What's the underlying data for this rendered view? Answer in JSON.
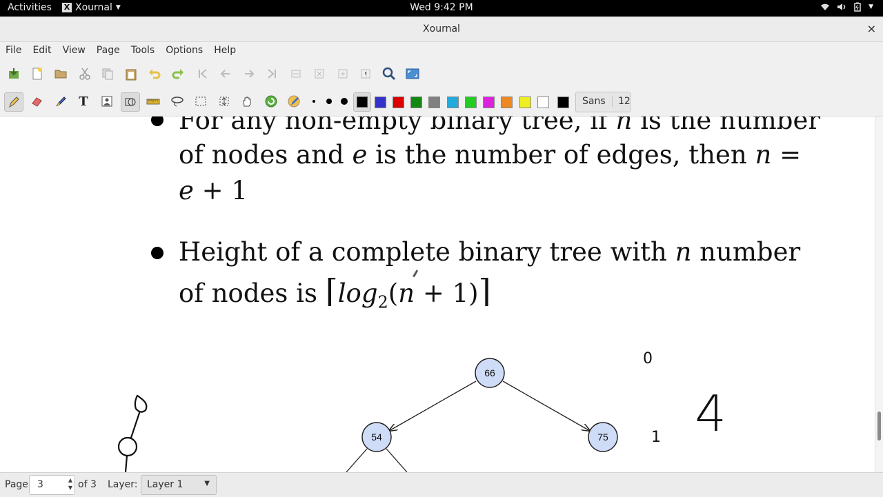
{
  "topbar": {
    "activities": "Activities",
    "app_name": "Xournal",
    "app_icon": "X",
    "clock": "Wed  9:42 PM"
  },
  "window": {
    "title": "Xournal",
    "close": "×"
  },
  "menu": {
    "items": [
      "File",
      "Edit",
      "View",
      "Page",
      "Tools",
      "Options",
      "Help"
    ]
  },
  "toolbar2": {
    "colors": [
      "#000000",
      "#3333cc",
      "#dd0000",
      "#118811",
      "#808080",
      "#22aadd",
      "#22cc22",
      "#dd22dd",
      "#ee8822",
      "#eeee22",
      "#ffffff",
      "#000000"
    ],
    "font_name": "Sans",
    "font_size": "12"
  },
  "document": {
    "bullet1": {
      "line1_a": "For any non-empty binary tree, if ",
      "line1_var": "n",
      "line1_b": " is the number",
      "line2_a": "of nodes and ",
      "line2_var1": "e",
      "line2_b": " is the number of edges, then ",
      "line2_var2": "n",
      "line2_c": " =",
      "line3_var": "e",
      "line3_b": " + 1"
    },
    "bullet2": {
      "line1_a": "Height of a complete binary tree with ",
      "line1_var": "n",
      "line1_b": " number",
      "line2_a": "of nodes is ",
      "lceil": "⌈",
      "log": "log",
      "sub": "2",
      "paren_open": "(",
      "var": "n",
      "rest": " + 1)",
      "rceil": "⌉"
    },
    "tree": {
      "root": "66",
      "left": "54",
      "right": "75"
    },
    "handwriting": {
      "digit_top": "0",
      "digit_mid": "1",
      "big_digit": "4"
    }
  },
  "status": {
    "page_label": "Page",
    "page_value": "3",
    "of_pages": "of 3",
    "layer_label": "Layer:",
    "layer_value": "Layer 1"
  }
}
